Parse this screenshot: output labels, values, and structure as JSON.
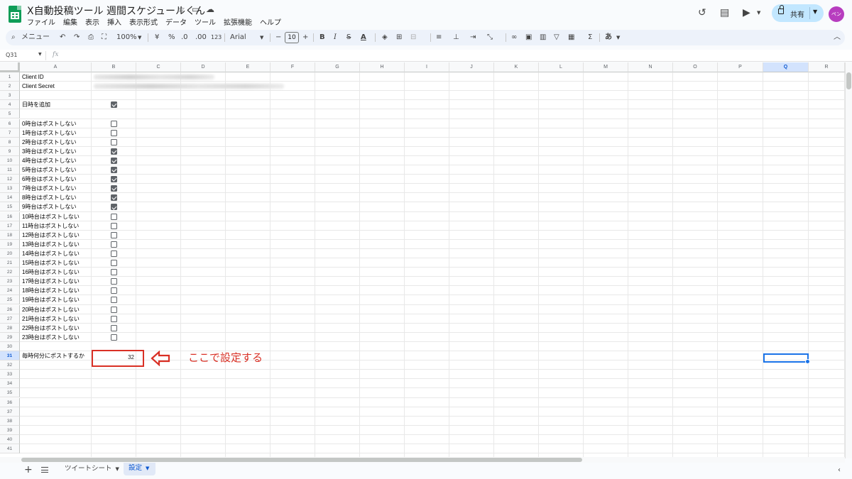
{
  "app": {
    "title": "X自動投稿ツール 週間スケジュールくん",
    "menu": [
      "ファイル",
      "編集",
      "表示",
      "挿入",
      "表示形式",
      "データ",
      "ツール",
      "拡張機能",
      "ヘルプ"
    ],
    "share_label": "共有",
    "avatar_text": "ペン"
  },
  "toolbar": {
    "menu_search": "メニュー",
    "zoom": "100%",
    "currency": "¥",
    "percent": "%",
    "decimal_decrease": ".0",
    "decimal_increase": ".00",
    "number_format": "123",
    "font": "Arial",
    "font_size": "10"
  },
  "formula_bar": {
    "name_box": "Q31",
    "fx": "fx",
    "value": ""
  },
  "columns": [
    "A",
    "B",
    "C",
    "D",
    "E",
    "F",
    "G",
    "H",
    "I",
    "J",
    "K",
    "L",
    "M",
    "N",
    "O",
    "P",
    "Q",
    "R"
  ],
  "selected_column": "Q",
  "selected_row": 31,
  "rows": [
    {
      "n": 1,
      "a": "Client ID",
      "b_blurred": true
    },
    {
      "n": 2,
      "a": "Client Secret",
      "b_blurred": true
    },
    {
      "n": 3,
      "a": ""
    },
    {
      "n": 4,
      "a": "日時を追加",
      "checkbox": true
    },
    {
      "n": 5,
      "a": ""
    },
    {
      "n": 6,
      "a": "0時台はポストしない",
      "checkbox": false
    },
    {
      "n": 7,
      "a": "1時台はポストしない",
      "checkbox": false
    },
    {
      "n": 8,
      "a": "2時台はポストしない",
      "checkbox": false
    },
    {
      "n": 9,
      "a": "3時台はポストしない",
      "checkbox": true
    },
    {
      "n": 10,
      "a": "4時台はポストしない",
      "checkbox": true
    },
    {
      "n": 11,
      "a": "5時台はポストしない",
      "checkbox": true
    },
    {
      "n": 12,
      "a": "6時台はポストしない",
      "checkbox": true
    },
    {
      "n": 13,
      "a": "7時台はポストしない",
      "checkbox": true
    },
    {
      "n": 14,
      "a": "8時台はポストしない",
      "checkbox": true
    },
    {
      "n": 15,
      "a": "9時台はポストしない",
      "checkbox": true
    },
    {
      "n": 16,
      "a": "10時台はポストしない",
      "checkbox": false
    },
    {
      "n": 17,
      "a": "11時台はポストしない",
      "checkbox": false
    },
    {
      "n": 18,
      "a": "12時台はポストしない",
      "checkbox": false
    },
    {
      "n": 19,
      "a": "13時台はポストしない",
      "checkbox": false
    },
    {
      "n": 20,
      "a": "14時台はポストしない",
      "checkbox": false
    },
    {
      "n": 21,
      "a": "15時台はポストしない",
      "checkbox": false
    },
    {
      "n": 22,
      "a": "16時台はポストしない",
      "checkbox": false
    },
    {
      "n": 23,
      "a": "17時台はポストしない",
      "checkbox": false
    },
    {
      "n": 24,
      "a": "18時台はポストしない",
      "checkbox": false
    },
    {
      "n": 25,
      "a": "19時台はポストしない",
      "checkbox": false
    },
    {
      "n": 26,
      "a": "20時台はポストしない",
      "checkbox": false
    },
    {
      "n": 27,
      "a": "21時台はポストしない",
      "checkbox": false
    },
    {
      "n": 28,
      "a": "22時台はポストしない",
      "checkbox": false
    },
    {
      "n": 29,
      "a": "23時台はポストしない",
      "checkbox": false
    },
    {
      "n": 30,
      "a": ""
    },
    {
      "n": 31,
      "a": "毎時何分にポストするか",
      "b": "32"
    },
    {
      "n": 32,
      "a": ""
    },
    {
      "n": 33,
      "a": ""
    },
    {
      "n": 34,
      "a": ""
    },
    {
      "n": 35,
      "a": ""
    },
    {
      "n": 36,
      "a": ""
    },
    {
      "n": 37,
      "a": ""
    },
    {
      "n": 38,
      "a": ""
    },
    {
      "n": 39,
      "a": ""
    },
    {
      "n": 40,
      "a": ""
    },
    {
      "n": 41,
      "a": ""
    }
  ],
  "annotation": {
    "text": "ここで設定する",
    "color": "#d93025"
  },
  "sheets": [
    {
      "name": "ツイートシート",
      "active": false
    },
    {
      "name": "設定",
      "active": true
    }
  ],
  "colors": {
    "accent": "#0b57d0",
    "share_bg": "#c2e7ff",
    "sheets_green": "#0f9d58",
    "highlight_red": "#d93025",
    "checkbox_gray": "#5f6368"
  }
}
